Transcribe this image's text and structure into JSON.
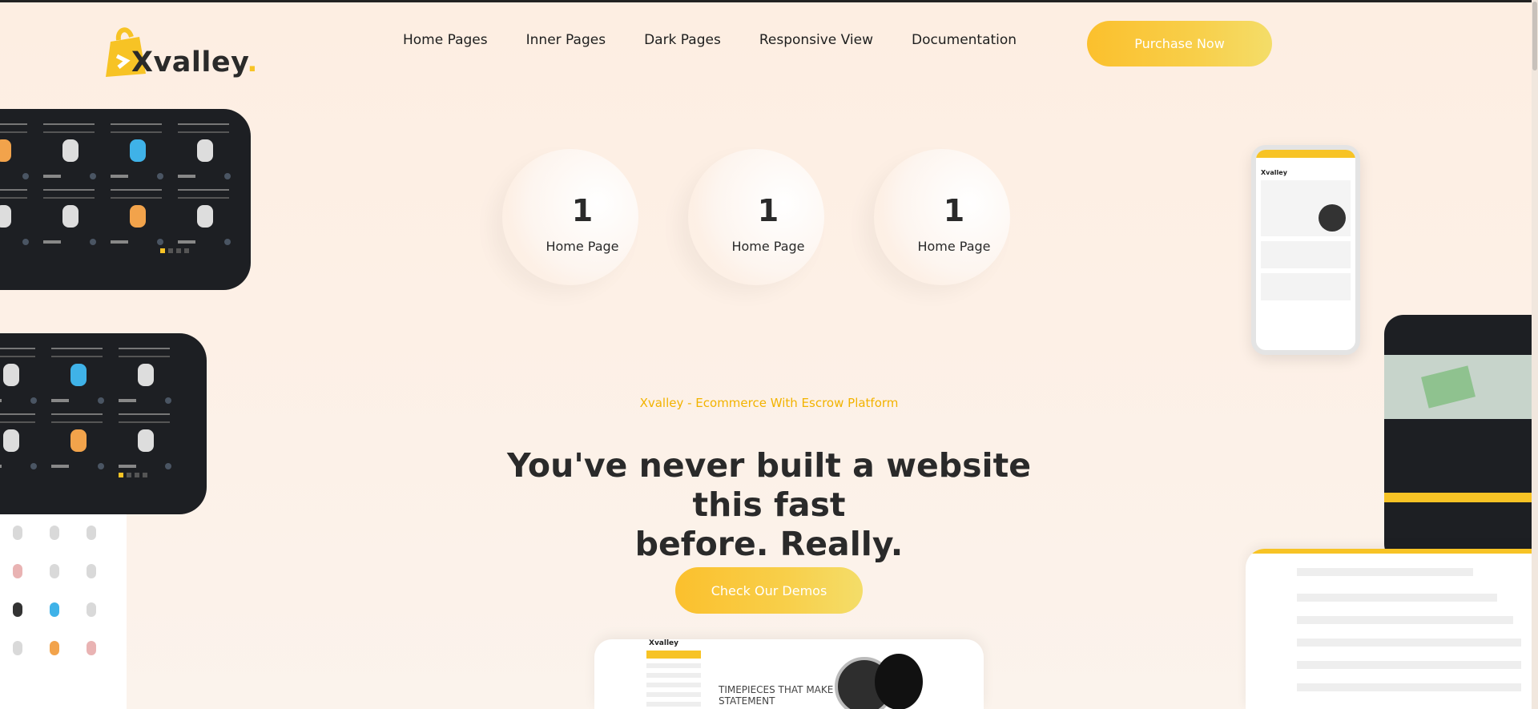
{
  "brand": {
    "name": "Xvalley",
    "dot": "."
  },
  "nav": {
    "items": [
      "Home Pages",
      "Inner Pages",
      "Dark Pages",
      "Responsive View",
      "Documentation"
    ]
  },
  "header": {
    "purchase_label": "Purchase Now"
  },
  "counters": [
    {
      "value": "1",
      "label": "Home Page"
    },
    {
      "value": "1",
      "label": "Home Page"
    },
    {
      "value": "1",
      "label": "Home Page"
    }
  ],
  "hero": {
    "tagline": "Xvalley - Ecommerce With Escrow Platform",
    "headline_line1": "You've never built a website this fast",
    "headline_line2": "before. Really.",
    "cta_label": "Check Our Demos"
  },
  "previews": {
    "laptop_heading": "TIMEPIECES THAT MAKE A STATEMENT"
  },
  "colors": {
    "accent": "#f7c325",
    "dark": "#1d1f23",
    "text": "#2a2a2a"
  }
}
